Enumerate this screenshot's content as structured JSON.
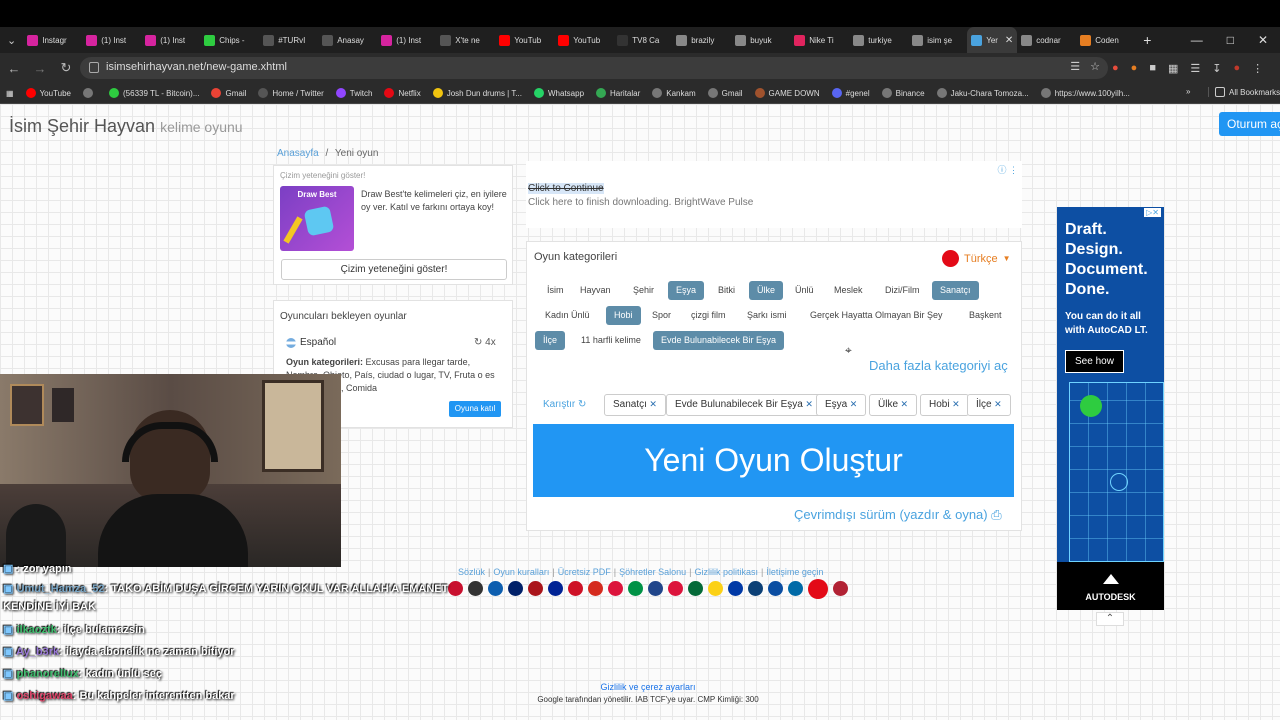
{
  "browser": {
    "tabs": [
      {
        "label": "Instagr",
        "color": "#d6249f"
      },
      {
        "label": "(1) Inst",
        "color": "#d6249f"
      },
      {
        "label": "(1) Inst",
        "color": "#d6249f"
      },
      {
        "label": "Chips -",
        "color": "#2ecc40"
      },
      {
        "label": "#TURvI",
        "color": "#555555"
      },
      {
        "label": "Anasay",
        "color": "#555555"
      },
      {
        "label": "(1) Inst",
        "color": "#d6249f"
      },
      {
        "label": "X'te ne",
        "color": "#555555"
      },
      {
        "label": "YouTub",
        "color": "#ff0000"
      },
      {
        "label": "YouTub",
        "color": "#ff0000"
      },
      {
        "label": "TV8 Ca",
        "color": "#333333"
      },
      {
        "label": "brazily",
        "color": "#888888"
      },
      {
        "label": "buyuk",
        "color": "#888888"
      },
      {
        "label": "Nike Ti",
        "color": "#e0245e"
      },
      {
        "label": "turkiye",
        "color": "#888888"
      },
      {
        "label": "isim şe",
        "color": "#888888"
      },
      {
        "label": "Yer",
        "color": "#4aa3df",
        "active": true
      },
      {
        "label": "codnar",
        "color": "#888888"
      },
      {
        "label": "Coden",
        "color": "#e67e22"
      }
    ],
    "new_tab": "+",
    "url": "isimsehirhayvan.net/new-game.xhtml",
    "bookmarks": [
      {
        "label": "YouTube",
        "color": "#ff0000"
      },
      {
        "label": "",
        "color": "#777777"
      },
      {
        "label": "(56339 TL - Bitcoin)...",
        "color": "#2ecc40"
      },
      {
        "label": "Gmail",
        "color": "#ea4335"
      },
      {
        "label": "Home / Twitter",
        "color": "#555555"
      },
      {
        "label": "Twitch",
        "color": "#9146ff"
      },
      {
        "label": "Netflix",
        "color": "#e50914"
      },
      {
        "label": "Josh Dun drums | T...",
        "color": "#f1c40f"
      },
      {
        "label": "Whatsapp",
        "color": "#25d366"
      },
      {
        "label": "Haritalar",
        "color": "#34a853"
      },
      {
        "label": "Kankam",
        "color": "#777777"
      },
      {
        "label": "Gmail",
        "color": "#777777"
      },
      {
        "label": "GAME DOWN",
        "color": "#a0522d"
      },
      {
        "label": "#genel",
        "color": "#5865f2"
      },
      {
        "label": "Binance",
        "color": "#777777"
      },
      {
        "label": "Jaku-Chara Tomoza...",
        "color": "#777777"
      },
      {
        "label": "https://www.100yilh...",
        "color": "#777777"
      }
    ],
    "all_bookmarks": "All Bookmarks"
  },
  "site": {
    "brand": "İsim Şehir Hayvan",
    "brand_sub": "kelime oyunu",
    "login": "Oturum aç",
    "breadcrumb_home": "Anasayfa",
    "breadcrumb_sep": "/",
    "breadcrumb_current": "Yeni oyun"
  },
  "draw_card": {
    "header": "Çizim yeteneğini göster!",
    "thumb_label": "Draw Best",
    "text": "Draw Best'te kelimeleri çiz, en iyilere oy ver. Katıl ve farkını ortaya koy!",
    "button": "Çizim yeteneğini göster!"
  },
  "waiting_card": {
    "title": "Oyuncuları bekleyen oyunlar",
    "language": "Español",
    "players": "4x",
    "categories_label": "Oyun kategorileri:",
    "categories_text": "Excusas para llegar tarde, Nombre, Objeto, País, ciudad o lugar, TV, Fruta o es de profesores, Comida",
    "join": "Oyuna katıl"
  },
  "top_ad": {
    "title": "Click to Continue",
    "subtitle": "Click here to finish downloading. BrightWave Pulse"
  },
  "categories": {
    "title": "Oyun kategorileri",
    "language": "Türkçe",
    "items": [
      {
        "label": "İsim",
        "selected": false
      },
      {
        "label": "Hayvan",
        "selected": false
      },
      {
        "label": "Şehir",
        "selected": false
      },
      {
        "label": "Eşya",
        "selected": true
      },
      {
        "label": "Bitki",
        "selected": false
      },
      {
        "label": "Ülke",
        "selected": true
      },
      {
        "label": "Ünlü",
        "selected": false
      },
      {
        "label": "Meslek",
        "selected": false
      },
      {
        "label": "Dizi/Film",
        "selected": false
      },
      {
        "label": "Sanatçı",
        "selected": true
      },
      {
        "label": "Kadın Ünlü",
        "selected": false
      },
      {
        "label": "Hobi",
        "selected": true
      },
      {
        "label": "Spor",
        "selected": false
      },
      {
        "label": "çizgi film",
        "selected": false
      },
      {
        "label": "Şarkı ismi",
        "selected": false
      },
      {
        "label": "Gerçek Hayatta Olmayan Bir Şey",
        "selected": false
      },
      {
        "label": "Başkent",
        "selected": false
      },
      {
        "label": "İlçe",
        "selected": true
      },
      {
        "label": "11 harfli kelime",
        "selected": false
      },
      {
        "label": "Evde Bulunabilecek Bir Eşya",
        "selected": true
      }
    ],
    "more": "Daha fazla kategoriyi aç",
    "shuffle": "Karıştır",
    "chosen": [
      "Sanatçı",
      "Evde Bulunabilecek Bir Eşya",
      "Eşya",
      "Ülke",
      "Hobi",
      "İlçe"
    ],
    "create": "Yeni Oyun Oluştur",
    "offline": "Çevrimdışı sürüm (yazdır & oyna)"
  },
  "side_ad": {
    "headline": "Draft. Design. Document. Done.",
    "body_prefix": "You can do it all with",
    "body_product": "AutoCAD LT.",
    "cta": "See how",
    "brand": "AUTODESK"
  },
  "footer": {
    "links": [
      "Sözlük",
      "Oyun kuralları",
      "Ücretsiz PDF",
      "Şöhretler Salonu",
      "Gizlilik politikası",
      "İletişime geçin"
    ],
    "link_sep": "|",
    "flags": [
      "#c8102e",
      "#333333",
      "#0d5eaf",
      "#012169",
      "#aa151b",
      "#002395",
      "#ce1126",
      "#d52b1e",
      "#dc143c",
      "#009246",
      "#21468b",
      "#dc143c",
      "#046a38",
      "#fcd116",
      "#0039a6",
      "#0c4076",
      "#0b4ea2",
      "#006aa7",
      "#e30a17",
      "#b22234"
    ],
    "privacy": "Gizlilik ve çerez ayarları",
    "google": "Google tarafından yönetilir. IAB TCF'ye uyar. CMP Kimliği: 300"
  },
  "chat": {
    "messages": [
      {
        "user": "",
        "text": "zor yapın",
        "color": "#9a79d8"
      },
      {
        "user": "Umut_Hamza_52",
        "text": "TAKO ABİM DUŞA GİRCEM YARIN OKUL VAR ALLAH'A EMANET KENDİNE İYİ BAK",
        "color": "#7aa7c7"
      },
      {
        "user": "ilkaoztk",
        "text": "ilçe bulamazsin",
        "color": "#3fbf6f"
      },
      {
        "user": "Ay_b3rk",
        "text": "ilayda abonelik ne zaman bitiyor",
        "color": "#9a79d8"
      },
      {
        "user": "phanorellux",
        "text": "kadın ünlü seç",
        "color": "#3fbf6f"
      },
      {
        "user": "oshigawaa",
        "text": "Bu kahpeler interentten bakar",
        "color": "#e0456a"
      }
    ]
  }
}
